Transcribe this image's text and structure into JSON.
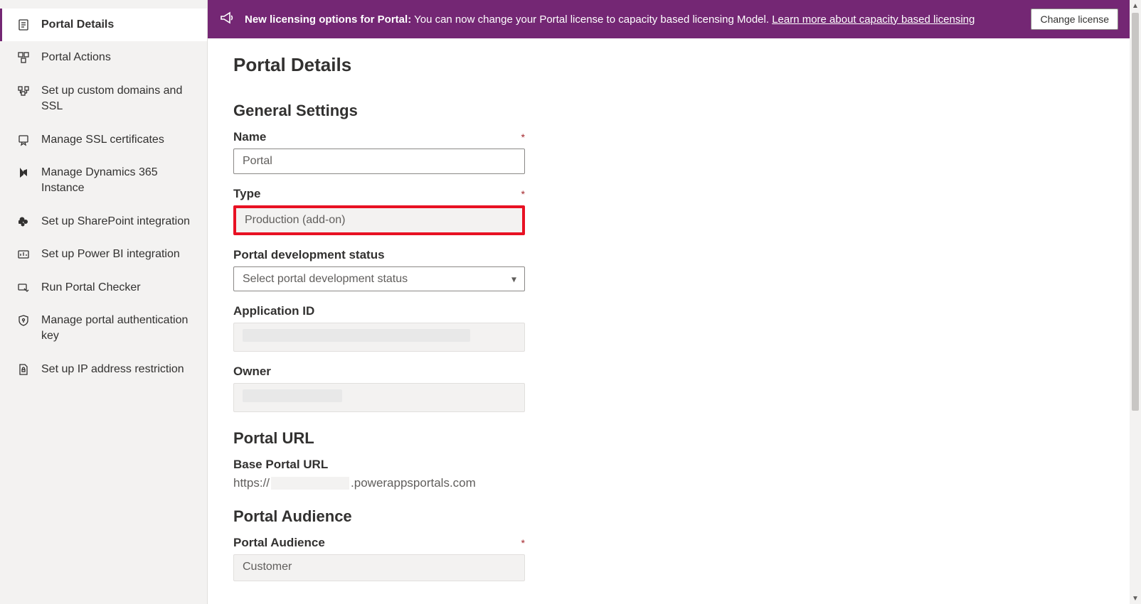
{
  "sidebar": {
    "items": [
      {
        "label": "Portal Details",
        "active": true
      },
      {
        "label": "Portal Actions"
      },
      {
        "label": "Set up custom domains and SSL"
      },
      {
        "label": "Manage SSL certificates"
      },
      {
        "label": "Manage Dynamics 365 Instance"
      },
      {
        "label": "Set up SharePoint integration"
      },
      {
        "label": "Set up Power BI integration"
      },
      {
        "label": "Run Portal Checker"
      },
      {
        "label": "Manage portal authentication key"
      },
      {
        "label": "Set up IP address restriction"
      }
    ]
  },
  "banner": {
    "bold": "New licensing options for Portal:",
    "text": "You can now change your Portal license to capacity based licensing Model.",
    "link": "Learn more about capacity based licensing",
    "button": "Change license"
  },
  "page": {
    "title": "Portal Details",
    "general": {
      "heading": "General Settings",
      "name_label": "Name",
      "name_value": "Portal",
      "type_label": "Type",
      "type_value": "Production (add-on)",
      "status_label": "Portal development status",
      "status_placeholder": "Select portal development status",
      "appid_label": "Application ID",
      "owner_label": "Owner"
    },
    "url": {
      "heading": "Portal URL",
      "base_label": "Base Portal URL",
      "prefix": "https://",
      "suffix": ".powerappsportals.com"
    },
    "audience": {
      "heading": "Portal Audience",
      "label": "Portal Audience",
      "value": "Customer"
    }
  }
}
